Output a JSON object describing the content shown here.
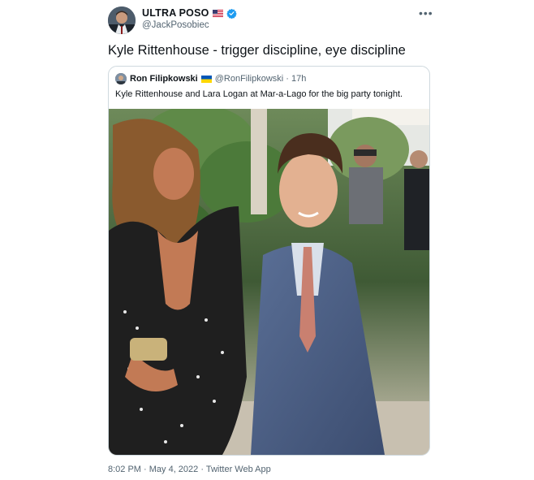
{
  "author": {
    "name": "ULTRA POSO",
    "handle": "@JackPosobiec",
    "flag_icon": "us-flag-icon",
    "verified_color": "#1d9bf0"
  },
  "tweet": {
    "text": "Kyle Rittenhouse - trigger discipline, eye discipline",
    "footer": "8:02 PM · May 4, 2022 · Twitter Web App"
  },
  "quoted": {
    "name": "Ron Filipkowski",
    "flag_icon": "ukraine-flag-icon",
    "handle_time": "@RonFilipkowski · 17h",
    "text": "Kyle Rittenhouse and Lara Logan at Mar-a-Lago for the big party tonight."
  },
  "colors": {
    "text": "#0f1419",
    "secondary": "#536471",
    "border": "#cfd9de"
  }
}
